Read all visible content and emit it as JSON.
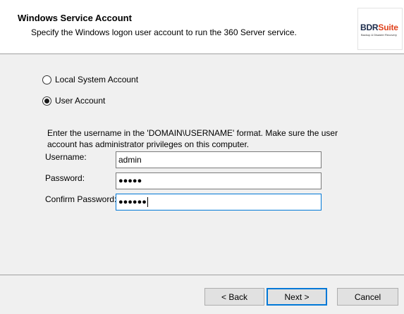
{
  "header": {
    "title": "Windows Service Account",
    "subtitle": "Specify the Windows logon user account to run the 360 Server service.",
    "logo": {
      "word_a": "BDR",
      "word_b": "Suite",
      "tagline": "Backup & Disaster Recovery"
    }
  },
  "account_type": {
    "options": [
      {
        "label": "Local System Account",
        "checked": false
      },
      {
        "label": "User Account",
        "checked": true
      }
    ]
  },
  "description": "Enter the username in the 'DOMAIN\\USERNAME' format. Make sure the user account has administrator privileges on this computer.",
  "form": {
    "username_label": "Username:",
    "username_value": "admin",
    "password_label": "Password:",
    "password_value": "●●●●●",
    "confirm_label": "Confirm Password:",
    "confirm_value": "●●●●●●"
  },
  "buttons": {
    "back": "< Back",
    "next": "Next >",
    "cancel": "Cancel"
  },
  "colors": {
    "focus_border": "#0078d7",
    "logo_primary": "#1a2a4a",
    "logo_accent": "#e0421c"
  }
}
